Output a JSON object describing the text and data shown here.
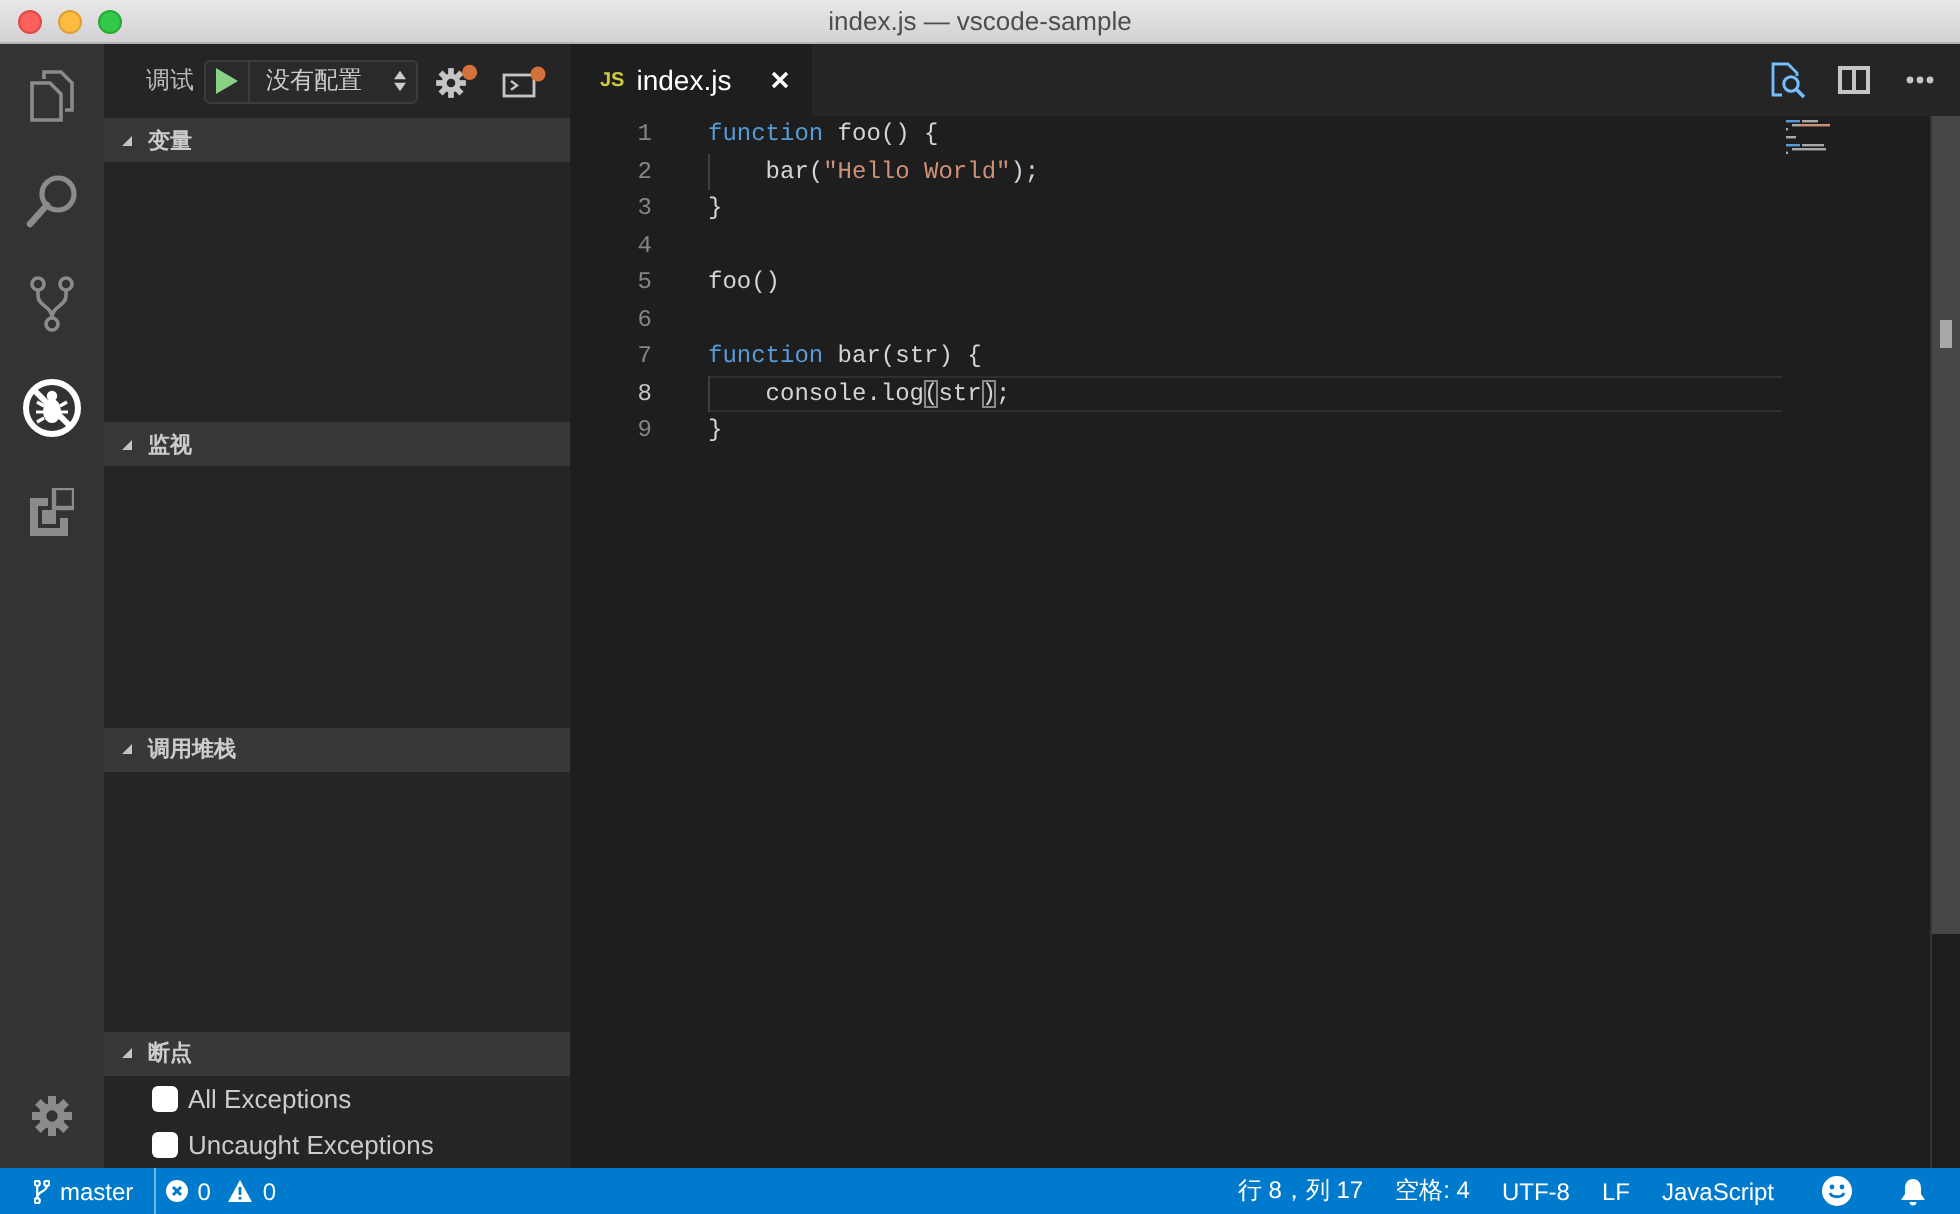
{
  "window": {
    "title": "index.js — vscode-sample"
  },
  "activity_bar": {
    "items": [
      {
        "kind": "files",
        "selected": false
      },
      {
        "kind": "search",
        "selected": false
      },
      {
        "kind": "source-control",
        "selected": false
      },
      {
        "kind": "debug",
        "selected": true
      },
      {
        "kind": "extensions",
        "selected": false
      }
    ]
  },
  "debug_toolbar": {
    "label": "调试",
    "configuration": "没有配置"
  },
  "sidebar": {
    "sections": [
      {
        "title": "变量",
        "expanded": true
      },
      {
        "title": "监视",
        "expanded": true
      },
      {
        "title": "调用堆栈",
        "expanded": true
      },
      {
        "title": "断点",
        "expanded": true,
        "items": [
          {
            "label": "All Exceptions",
            "checked": false
          },
          {
            "label": "Uncaught Exceptions",
            "checked": false
          }
        ]
      }
    ]
  },
  "editor": {
    "tabs": [
      {
        "icon_label": "JS",
        "label": "index.js",
        "selected": true
      }
    ],
    "lines": [
      {
        "number": "1",
        "current": false,
        "tokens": [
          {
            "kind": "keyword",
            "text": "function"
          },
          {
            "kind": "plain",
            "text": " foo() {"
          }
        ],
        "children": [
          {
            "number": "2",
            "current": false,
            "tokens": [
              {
                "kind": "plain",
                "text": "bar("
              },
              {
                "kind": "string",
                "text": "\"Hello World\""
              },
              {
                "kind": "plain",
                "text": ");"
              }
            ]
          }
        ]
      },
      {
        "number": "3",
        "current": false,
        "tokens": [
          {
            "kind": "plain",
            "text": "}"
          }
        ]
      },
      {
        "number": "4",
        "current": false
      },
      {
        "number": "5",
        "current": false,
        "tokens": [
          {
            "kind": "plain",
            "text": "foo()"
          }
        ]
      },
      {
        "number": "6",
        "current": false
      },
      {
        "number": "7",
        "current": false,
        "tokens": [
          {
            "kind": "keyword",
            "text": "function"
          },
          {
            "kind": "plain",
            "text": " bar(str) {"
          }
        ],
        "children": [
          {
            "number": "8",
            "current": true,
            "tokens": [
              {
                "kind": "plain",
                "text": "console.log"
              },
              {
                "kind": "bracket-match",
                "text": "("
              },
              {
                "kind": "plain",
                "text": "str"
              },
              {
                "kind": "bracket-match",
                "text": ")"
              },
              {
                "kind": "plain",
                "text": ";"
              }
            ]
          }
        ]
      },
      {
        "number": "9",
        "current": false,
        "tokens": [
          {
            "kind": "plain",
            "text": "}"
          }
        ]
      }
    ]
  },
  "status_bar": {
    "branch": "master",
    "errors": "0",
    "warnings": "0",
    "items": [
      "行 8，列 17",
      "空格: 4",
      "UTF-8",
      "LF",
      "JavaScript"
    ]
  }
}
